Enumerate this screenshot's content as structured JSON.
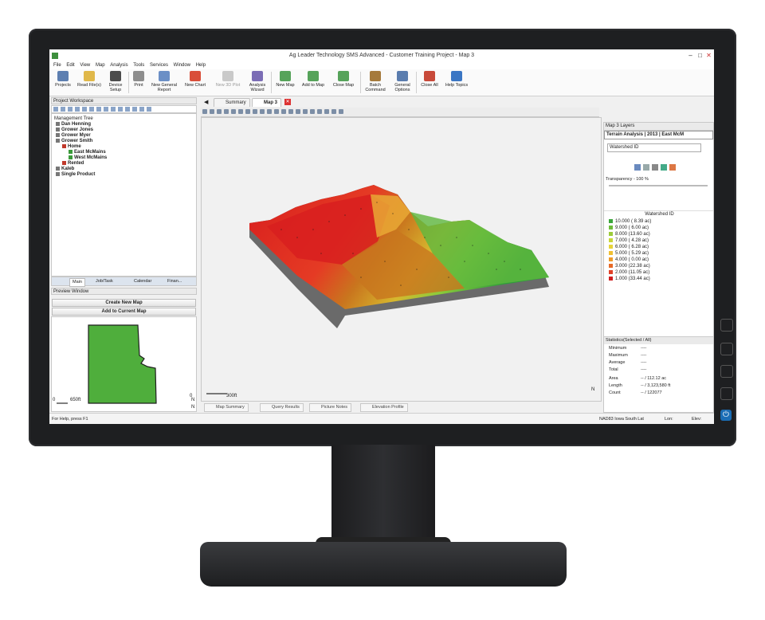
{
  "window": {
    "title": "Ag Leader Technology SMS Advanced - Customer Training Project - Map 3"
  },
  "menu": [
    "File",
    "Edit",
    "View",
    "Map",
    "Analysis",
    "Tools",
    "Services",
    "Window",
    "Help"
  ],
  "ribbon": [
    {
      "label": "Projects",
      "icon": "projects-icon"
    },
    {
      "label": "Read File(s)",
      "icon": "read-file-icon"
    },
    {
      "label": "Device\nSetup",
      "icon": "device-setup-icon"
    },
    {
      "label": "Print",
      "icon": "print-icon"
    },
    {
      "label": "New General\nReport",
      "icon": "report-icon"
    },
    {
      "label": "New Chart",
      "icon": "chart-icon"
    },
    {
      "label": "New 3D Plot",
      "icon": "3d-plot-icon"
    },
    {
      "label": "Analysis\nWizard",
      "icon": "wizard-icon"
    },
    {
      "label": "New Map",
      "icon": "new-map-icon"
    },
    {
      "label": "Add to Map",
      "icon": "add-map-icon"
    },
    {
      "label": "Close Map",
      "icon": "close-map-icon"
    },
    {
      "label": "Batch\nCommand",
      "icon": "batch-icon"
    },
    {
      "label": "General\nOptions",
      "icon": "options-icon"
    },
    {
      "label": "Close All",
      "icon": "close-all-icon"
    },
    {
      "label": "Help Topics",
      "icon": "help-icon"
    }
  ],
  "project_workspace": {
    "title": "Project Workspace",
    "tree_header": "Management Tree",
    "tree": [
      {
        "label": "Dan Henning",
        "level": 1
      },
      {
        "label": "Grower Jones",
        "level": 1
      },
      {
        "label": "Grower Myer",
        "level": 1
      },
      {
        "label": "Grower Smith",
        "level": 1
      },
      {
        "label": "Home",
        "level": 2
      },
      {
        "label": "East McMains",
        "level": 3
      },
      {
        "label": "West McMains",
        "level": 3
      },
      {
        "label": "Rented",
        "level": 2
      },
      {
        "label": "Kaleb",
        "level": 1
      },
      {
        "label": "Single Product",
        "level": 1
      }
    ],
    "tabs": [
      "Main",
      "Job/Task",
      "Calendar",
      "Finan..."
    ]
  },
  "preview": {
    "title": "Preview Window",
    "create_button": "Create New Map",
    "add_button": "Add to Current Map",
    "scale_label": "650ft",
    "north": "N",
    "field_color": "#4fae3c"
  },
  "doc_tabs": {
    "summary": "Summary",
    "map": "Map 3"
  },
  "map": {
    "scale_label": "300ft",
    "north": "N",
    "colors": [
      "#d81e1e",
      "#e7442a",
      "#c9761e",
      "#d9a024",
      "#e2c83a",
      "#a6c93a",
      "#6fbe3e",
      "#2f9e3a"
    ]
  },
  "bottom_tabs": [
    "Map Summary",
    "Query Results",
    "Picture Notes",
    "Elevation Profile"
  ],
  "layers": {
    "title": "Map 3 Layers",
    "layer_name": "Terrain Analysis | 2013 | East McM",
    "attribute": "Watershed ID",
    "transparency": "Transparency - 100 %",
    "legend_title": "Watershed ID",
    "legend": [
      {
        "label": "10.000 ( 8.39 ac)",
        "color": "#3aa63a"
      },
      {
        "label": "9.000 ( 6.00 ac)",
        "color": "#6dbd3a"
      },
      {
        "label": "8.000 (13.60 ac)",
        "color": "#9ccc3a"
      },
      {
        "label": "7.000 ( 4.28 ac)",
        "color": "#c8d63a"
      },
      {
        "label": "6.000 ( 6.28 ac)",
        "color": "#e8d43a"
      },
      {
        "label": "5.000 ( 5.29 ac)",
        "color": "#f0c032"
      },
      {
        "label": "4.000 ( 0.00 ac)",
        "color": "#ee9a2a"
      },
      {
        "label": "3.000 (22.38 ac)",
        "color": "#e86a28"
      },
      {
        "label": "2.000 (11.05 ac)",
        "color": "#e04026"
      },
      {
        "label": "1.000 (33.44 ac)",
        "color": "#d01e1e"
      }
    ],
    "stats_title": "Statistics(Selected / All)",
    "stats": [
      {
        "name": "Minimum",
        "value": "----"
      },
      {
        "name": "Maximum",
        "value": "----"
      },
      {
        "name": "Average",
        "value": "----"
      },
      {
        "name": "Total",
        "value": "----"
      },
      {
        "name": "Area",
        "value": "-- / 112.12 ac"
      },
      {
        "name": "Length",
        "value": "-- / 3,123,580 ft"
      },
      {
        "name": "Count",
        "value": "-- / 122077"
      }
    ]
  },
  "status": {
    "left": "For Help, press F1",
    "projection": "NAD83 Iowa South Lat",
    "lon": "Lon:",
    "elev": "Elev:"
  }
}
